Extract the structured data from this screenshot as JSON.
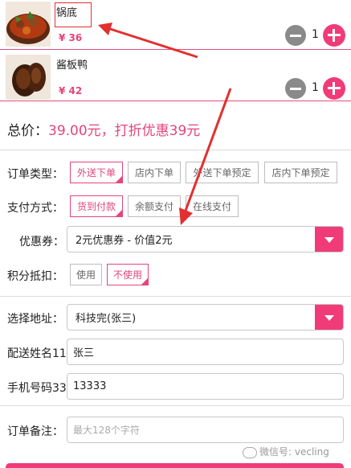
{
  "cart": {
    "items": [
      {
        "name": "锅底",
        "price": "¥ 36",
        "qty": "1"
      },
      {
        "name": "酱板鸭",
        "price": "¥ 42",
        "qty": "1"
      }
    ]
  },
  "summary": {
    "label": "总价：",
    "amount": "39.00元，打折优惠39元"
  },
  "order_type": {
    "label": "订单类型：",
    "options": [
      "外送下单",
      "店内下单",
      "外送下单预定",
      "店内下单预定"
    ],
    "selected": "外送下单"
  },
  "payment": {
    "label": "支付方式：",
    "options": [
      "货到付款",
      "余额支付",
      "在线支付"
    ],
    "selected": "货到付款"
  },
  "coupon": {
    "label": "优惠券：",
    "value": "2元优惠券 - 价值2元"
  },
  "points": {
    "label": "积分抵扣：",
    "options": [
      "使用",
      "不使用"
    ],
    "selected": "不使用"
  },
  "address": {
    "label": "选择地址：",
    "value": "科技完(张三)"
  },
  "recipient": {
    "label": "配送姓名11",
    "value": "张三"
  },
  "phone": {
    "label": "手机号码33",
    "value": "13333"
  },
  "remark": {
    "label": "订单备注：",
    "placeholder": "最大128个字符"
  },
  "watermark": "微信号: vecling",
  "colors": {
    "accent": "#f03b78",
    "price": "#e4457a",
    "annotation": "#e23030"
  }
}
